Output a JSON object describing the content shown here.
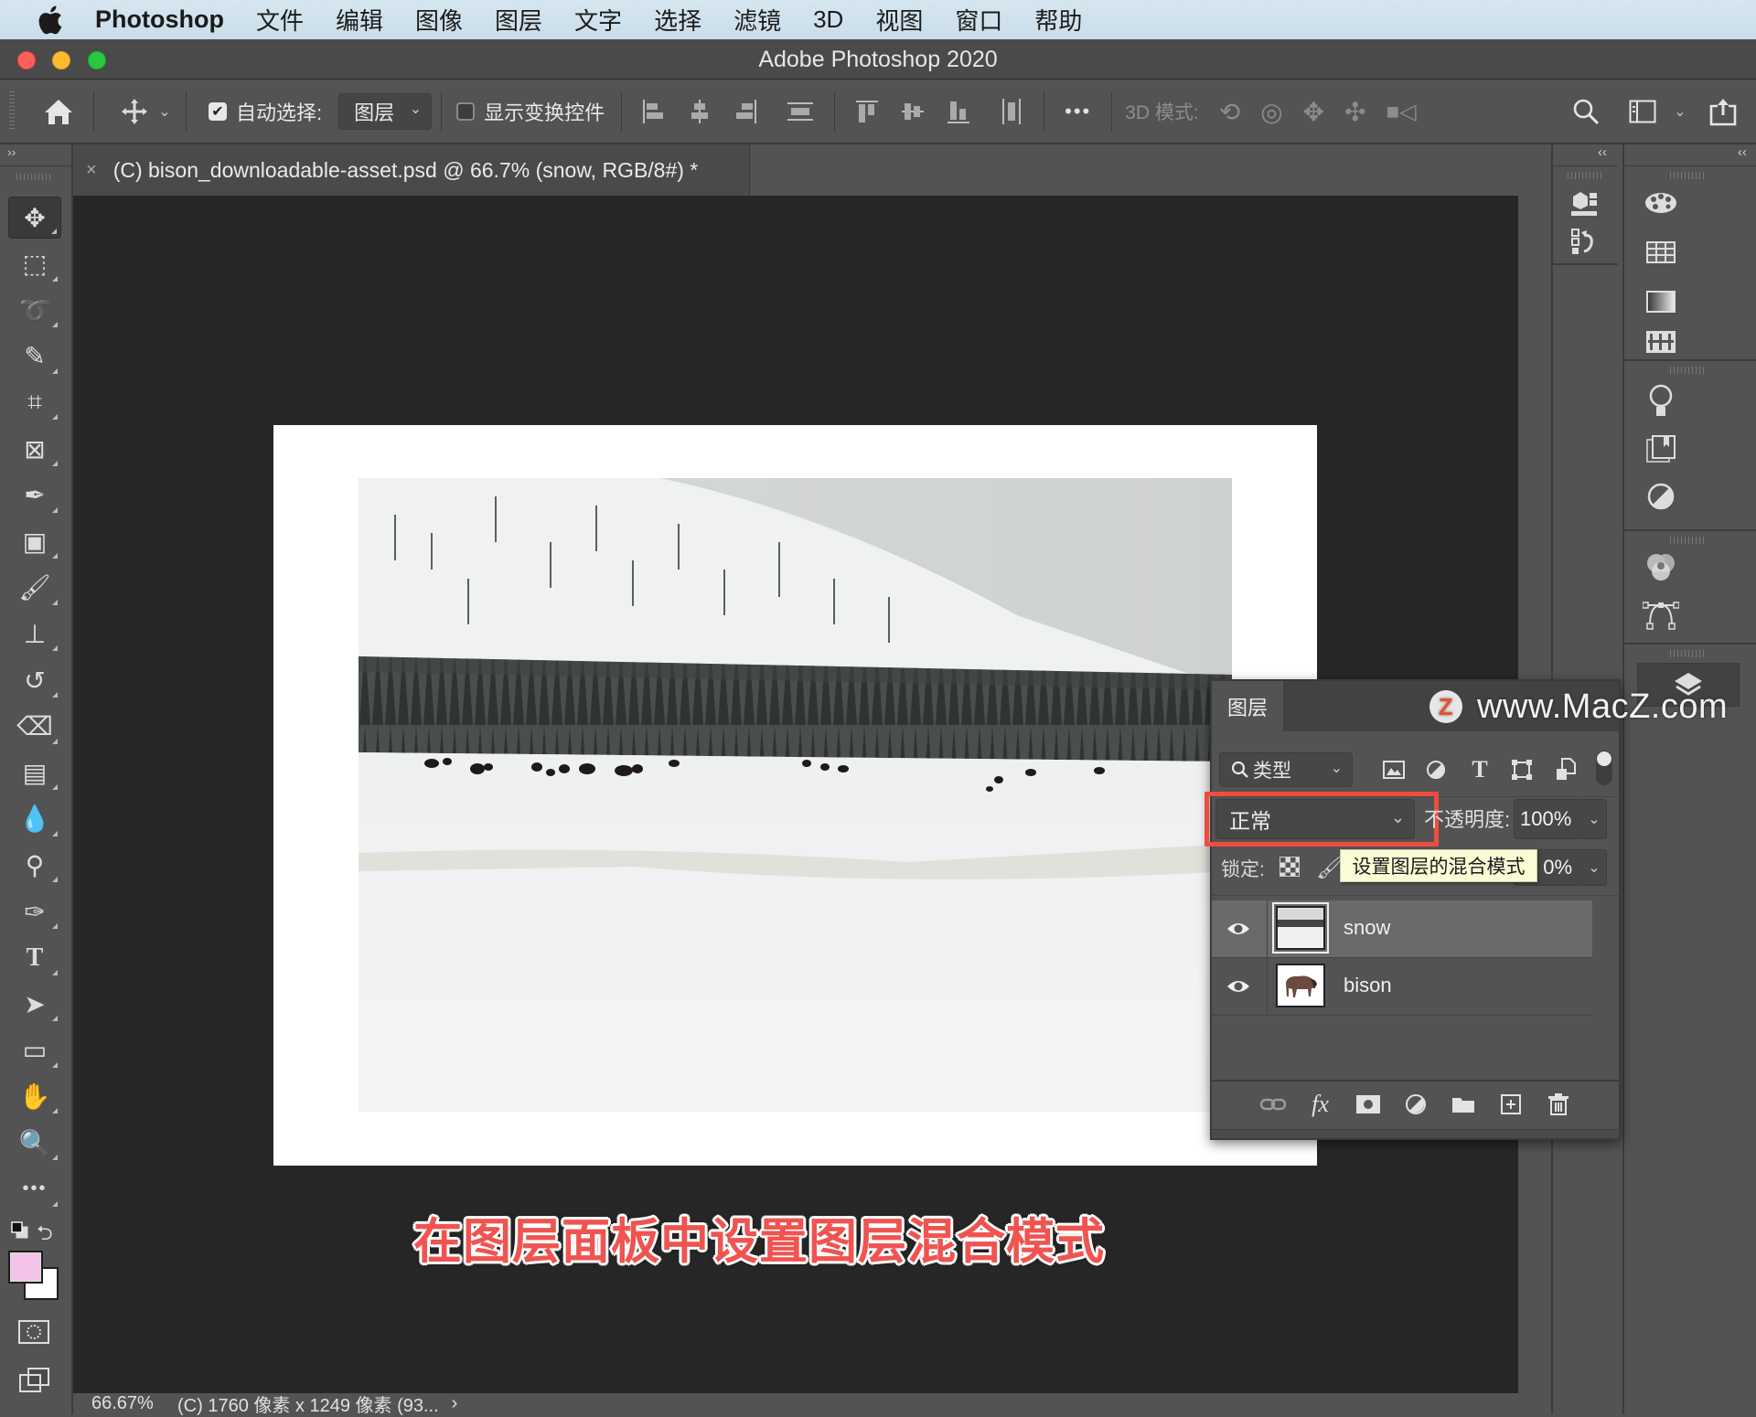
{
  "menubar": {
    "app_name": "Photoshop",
    "items": [
      "文件",
      "编辑",
      "图像",
      "图层",
      "文字",
      "选择",
      "滤镜",
      "3D",
      "视图",
      "窗口",
      "帮助"
    ]
  },
  "window": {
    "title": "Adobe Photoshop 2020"
  },
  "options_bar": {
    "auto_select_label": "自动选择:",
    "auto_select_checked": true,
    "auto_select_target": "图层",
    "show_transform_label": "显示变换控件",
    "show_transform_checked": false,
    "more_label": "•••",
    "mode_3d_label": "3D 模式:"
  },
  "tools_header": "››",
  "tools": [
    {
      "name": "move-tool",
      "glyph": "✥",
      "active": true
    },
    {
      "name": "rectangular-marquee-tool",
      "glyph": "⬚"
    },
    {
      "name": "lasso-tool",
      "glyph": "➰"
    },
    {
      "name": "quick-selection-tool",
      "glyph": "✎"
    },
    {
      "name": "crop-tool",
      "glyph": "⌗"
    },
    {
      "name": "frame-tool",
      "glyph": "⊠"
    },
    {
      "name": "eyedropper-tool",
      "glyph": "✒"
    },
    {
      "name": "spot-healing-tool",
      "glyph": "▣"
    },
    {
      "name": "brush-tool",
      "glyph": "🖌"
    },
    {
      "name": "clone-stamp-tool",
      "glyph": "⊥"
    },
    {
      "name": "history-brush-tool",
      "glyph": "↺"
    },
    {
      "name": "eraser-tool",
      "glyph": "⌫"
    },
    {
      "name": "gradient-tool",
      "glyph": "▤"
    },
    {
      "name": "blur-tool",
      "glyph": "💧"
    },
    {
      "name": "dodge-tool",
      "glyph": "⚲"
    },
    {
      "name": "pen-tool",
      "glyph": "✑"
    },
    {
      "name": "type-tool",
      "glyph": "T"
    },
    {
      "name": "path-selection-tool",
      "glyph": "➤"
    },
    {
      "name": "rectangle-tool",
      "glyph": "▭"
    },
    {
      "name": "hand-tool",
      "glyph": "✋"
    },
    {
      "name": "zoom-tool",
      "glyph": "🔍"
    },
    {
      "name": "edit-toolbar",
      "glyph": "•••"
    }
  ],
  "colors": {
    "foreground": "#f4c4e8",
    "background": "#ffffff",
    "highlight": "#ef4c40",
    "caption": "#ef5450"
  },
  "document": {
    "tab_title": "(C) bison_downloadable-asset.psd @ 66.7% (snow, RGB/8#) *",
    "close_label": "×"
  },
  "caption": "在图层面板中设置图层混合模式",
  "status": {
    "zoom": "66.67%",
    "info": "(C) 1760 像素 x 1249 像素 (93...",
    "arrow": "›"
  },
  "right_panel": {
    "collapse_label": "‹‹"
  },
  "layers_panel": {
    "tab_label": "图层",
    "watermark": "www.MacZ.com",
    "watermark_logo": "Z",
    "filter_label": "类型",
    "blend_mode": "正常",
    "opacity_label": "不透明度:",
    "opacity_value": "100%",
    "lock_label": "锁定:",
    "fill_value": "0%",
    "tooltip": "设置图层的混合模式",
    "layers": [
      {
        "name": "snow",
        "visible": true,
        "selected": true
      },
      {
        "name": "bison",
        "visible": true,
        "selected": false
      }
    ]
  }
}
